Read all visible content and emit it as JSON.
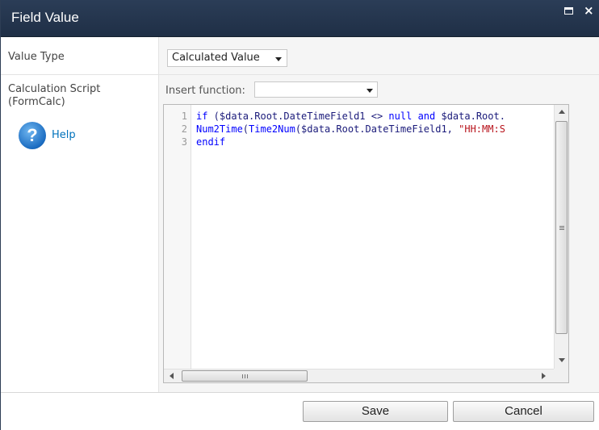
{
  "window": {
    "title": "Field Value",
    "maximize_icon": "maximize-icon",
    "close_icon": "close-icon",
    "close_glyph": "×"
  },
  "value_type": {
    "label": "Value Type",
    "selected": "Calculated Value"
  },
  "calculation": {
    "label_line1": "Calculation Script",
    "label_line2": "(FormCalc)",
    "help_icon": "help-icon",
    "help_glyph": "?",
    "help_label": "Help",
    "insert_function_label": "Insert function:",
    "insert_function_selected": ""
  },
  "editor": {
    "line_numbers": [
      "1",
      "2",
      "3"
    ],
    "lines": [
      [
        {
          "cls": "kw",
          "text": "if"
        },
        {
          "cls": "tx",
          "text": " ($data.Root.DateTimeField1 <> "
        },
        {
          "cls": "kw",
          "text": "null"
        },
        {
          "cls": "tx",
          "text": " "
        },
        {
          "cls": "kw",
          "text": "and"
        },
        {
          "cls": "tx",
          "text": " $data.Root."
        }
      ],
      [
        {
          "cls": "kw",
          "text": "Num2Time"
        },
        {
          "cls": "tx",
          "text": "("
        },
        {
          "cls": "kw",
          "text": "Time2Num"
        },
        {
          "cls": "tx",
          "text": "($data.Root.DateTimeField1, "
        },
        {
          "cls": "str",
          "text": "\"HH:MM:S"
        }
      ],
      [
        {
          "cls": "kw",
          "text": "endif"
        }
      ]
    ]
  },
  "footer": {
    "save_label": "Save",
    "cancel_label": "Cancel"
  },
  "colors": {
    "titlebar": "#24354d",
    "keyword": "#0000ff",
    "string": "#b8141c",
    "link": "#0072bc"
  }
}
